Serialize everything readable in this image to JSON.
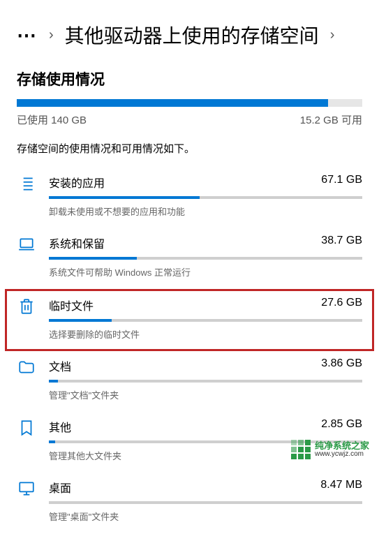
{
  "breadcrumb": {
    "dots": "⋯",
    "title": "其他驱动器上使用的存储空间"
  },
  "heading": "存储使用情况",
  "total": {
    "used_label": "已使用 140 GB",
    "free_label": "15.2 GB 可用",
    "fill_percent": 90
  },
  "description": "存储空间的使用情况和可用情况如下。",
  "categories": [
    {
      "name": "安装的应用",
      "size": "67.1 GB",
      "sub": "卸载未使用或不想要的应用和功能",
      "fill": 48,
      "icon": "list-icon",
      "highlighted": false
    },
    {
      "name": "系统和保留",
      "size": "38.7 GB",
      "sub": "系统文件可帮助 Windows 正常运行",
      "fill": 28,
      "icon": "laptop-icon",
      "highlighted": false
    },
    {
      "name": "临时文件",
      "size": "27.6 GB",
      "sub": "选择要删除的临时文件",
      "fill": 20,
      "icon": "trash-icon",
      "highlighted": true
    },
    {
      "name": "文档",
      "size": "3.86 GB",
      "sub": "管理\"文档\"文件夹",
      "fill": 3,
      "icon": "folder-icon",
      "highlighted": false
    },
    {
      "name": "其他",
      "size": "2.85 GB",
      "sub": "管理其他大文件夹",
      "fill": 2,
      "icon": "bookmark-icon",
      "highlighted": false
    },
    {
      "name": "桌面",
      "size": "8.47 MB",
      "sub": "管理\"桌面\"文件夹",
      "fill": 0,
      "icon": "monitor-icon",
      "highlighted": false
    }
  ],
  "watermark": {
    "text": "纯净系统之家",
    "url": "www.ycwjz.com"
  }
}
